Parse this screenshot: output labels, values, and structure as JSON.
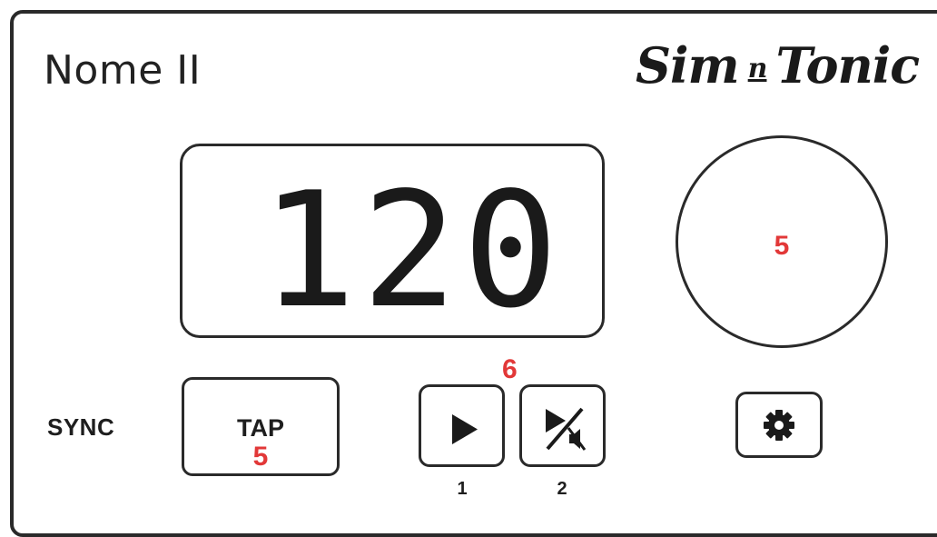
{
  "app": {
    "title": "Nome II",
    "brand": "Sim n Tonic"
  },
  "display": {
    "tempo": "120"
  },
  "knob": {
    "badge": "5"
  },
  "controls": {
    "sync_label": "SYNC",
    "tap_label": "TAP",
    "tap_badge": "5",
    "group_badge": "6",
    "play_number": "1",
    "play_mute_number": "2"
  },
  "icons": {
    "play": "play-icon",
    "play_mute": "play-mute-icon",
    "settings": "gear-icon"
  },
  "colors": {
    "ink": "#1e1e1e",
    "badge": "#e23838",
    "background": "#ffffff"
  }
}
